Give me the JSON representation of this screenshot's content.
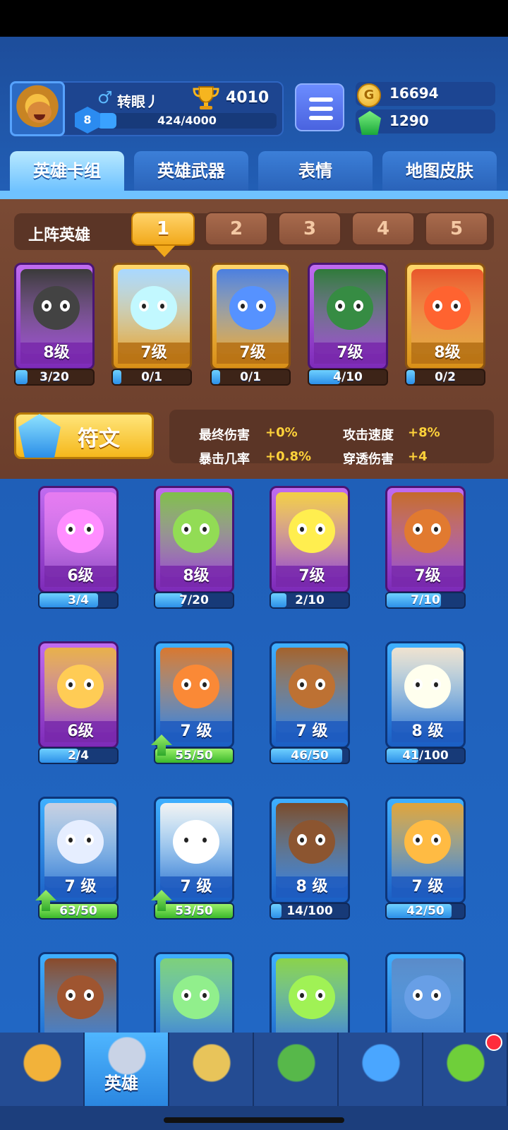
{
  "player": {
    "name": "转眼丿",
    "trophies": "4010",
    "level": "8",
    "xp": "424/4000",
    "xp_fraction": 0.106
  },
  "currency": {
    "gold": "16694",
    "gems": "1290"
  },
  "tabs": [
    {
      "label": "英雄卡组",
      "active": true
    },
    {
      "label": "英雄武器",
      "active": false
    },
    {
      "label": "表情",
      "active": false
    },
    {
      "label": "地图皮肤",
      "active": false
    }
  ],
  "lineup": {
    "label": "上阵英雄",
    "slots": [
      "1",
      "2",
      "3",
      "4",
      "5"
    ],
    "active_slot": 0,
    "heroes": [
      {
        "level": "8级",
        "progress": "3/20",
        "fraction": 0.15,
        "rarity": "purple",
        "color": "#3a3a3a"
      },
      {
        "level": "7级",
        "progress": "0/1",
        "fraction": 0.0,
        "rarity": "gold",
        "color": "#a9d8ff"
      },
      {
        "level": "7级",
        "progress": "0/1",
        "fraction": 0.0,
        "rarity": "gold",
        "color": "#4b7fe0"
      },
      {
        "level": "7级",
        "progress": "4/10",
        "fraction": 0.4,
        "rarity": "purple",
        "color": "#2f7a3a"
      },
      {
        "level": "8级",
        "progress": "0/2",
        "fraction": 0.0,
        "rarity": "gold",
        "color": "#e8562a"
      }
    ]
  },
  "rune": {
    "label": "符文"
  },
  "stats": [
    {
      "name": "最终伤害",
      "value": "+0%"
    },
    {
      "name": "攻击速度",
      "value": "+8%"
    },
    {
      "name": "暴击几率",
      "value": "+0.8%"
    },
    {
      "name": "穿透伤害",
      "value": "+4"
    }
  ],
  "collection": [
    {
      "level": "6级",
      "progress": "3/4",
      "fraction": 0.75,
      "rarity": "purple",
      "color": "#e67bf0",
      "upgrade": false
    },
    {
      "level": "8级",
      "progress": "7/20",
      "fraction": 0.35,
      "rarity": "purple",
      "color": "#7fbf4a",
      "upgrade": false
    },
    {
      "level": "7级",
      "progress": "2/10",
      "fraction": 0.2,
      "rarity": "purple",
      "color": "#f2cf45",
      "upgrade": false
    },
    {
      "level": "7级",
      "progress": "7/10",
      "fraction": 0.7,
      "rarity": "purple",
      "color": "#c46a2a",
      "upgrade": false
    },
    {
      "level": "6级",
      "progress": "2/4",
      "fraction": 0.5,
      "rarity": "purple",
      "color": "#e8b14a",
      "upgrade": false
    },
    {
      "level": "7 级",
      "progress": "55/50",
      "fraction": 1.0,
      "rarity": "blue",
      "color": "#d9772f",
      "upgrade": true
    },
    {
      "level": "7 级",
      "progress": "46/50",
      "fraction": 0.92,
      "rarity": "blue",
      "color": "#a4622c",
      "upgrade": false
    },
    {
      "level": "8 级",
      "progress": "41/100",
      "fraction": 0.41,
      "rarity": "blue",
      "color": "#f0e2cf",
      "upgrade": false
    },
    {
      "level": "7 级",
      "progress": "63/50",
      "fraction": 1.0,
      "rarity": "blue",
      "color": "#c8cfe0",
      "upgrade": true
    },
    {
      "level": "7 级",
      "progress": "53/50",
      "fraction": 1.0,
      "rarity": "blue",
      "color": "#f2f2f2",
      "upgrade": true
    },
    {
      "level": "8 级",
      "progress": "14/100",
      "fraction": 0.14,
      "rarity": "blue",
      "color": "#7a4a2a",
      "upgrade": false
    },
    {
      "level": "7 级",
      "progress": "42/50",
      "fraction": 0.84,
      "rarity": "blue",
      "color": "#e0a33a",
      "upgrade": false
    },
    {
      "level": "",
      "progress": "",
      "fraction": 0,
      "rarity": "blue",
      "color": "#8a4a2a",
      "upgrade": false
    },
    {
      "level": "",
      "progress": "",
      "fraction": 0,
      "rarity": "blue",
      "color": "#7ed07a",
      "upgrade": false
    },
    {
      "level": "",
      "progress": "",
      "fraction": 0,
      "rarity": "blue",
      "color": "#8bd24a",
      "upgrade": false
    },
    {
      "level": "",
      "progress": "",
      "fraction": 0,
      "rarity": "blue",
      "color": "#5a8ac8",
      "upgrade": false
    }
  ],
  "nav": [
    {
      "icon": "treasure-chest-icon",
      "label": "",
      "active": false
    },
    {
      "icon": "knight-helmet-icon",
      "label": "英雄",
      "active": true
    },
    {
      "icon": "crossed-swords-icon",
      "label": "",
      "active": false
    },
    {
      "icon": "crown-shield-icon",
      "label": "",
      "active": false
    },
    {
      "icon": "friends-banner-icon",
      "label": "",
      "active": false
    },
    {
      "icon": "sprout-island-icon",
      "label": "",
      "active": false,
      "badge": true
    }
  ]
}
